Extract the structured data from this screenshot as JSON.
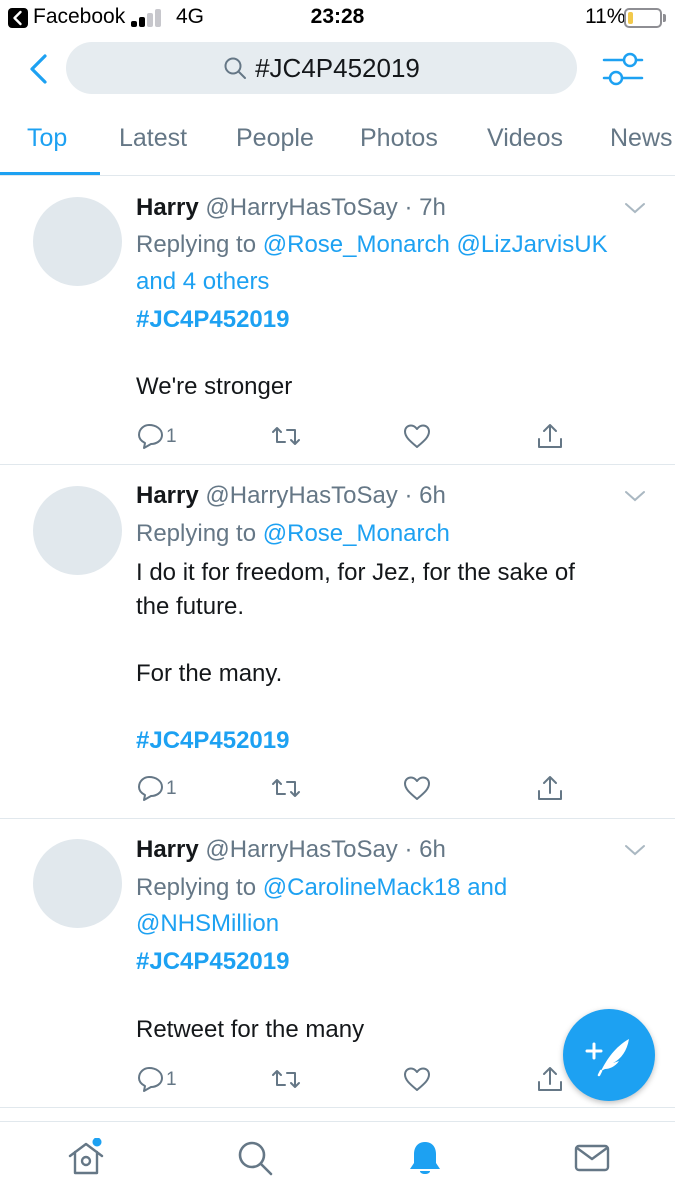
{
  "status_bar": {
    "back_app": "Facebook",
    "network": "4G",
    "time": "23:28",
    "battery": "11%"
  },
  "search": {
    "query": "#JC4P452019"
  },
  "tabs": [
    {
      "label": "Top",
      "active": true
    },
    {
      "label": "Latest",
      "active": false
    },
    {
      "label": "People",
      "active": false
    },
    {
      "label": "Photos",
      "active": false
    },
    {
      "label": "Videos",
      "active": false
    },
    {
      "label": "News",
      "active": false
    }
  ],
  "tweets": [
    {
      "name": "Harry",
      "handle_time": "@HarryHasToSay · 7h",
      "replying_prefix": "Replying to",
      "replying_line1": "@Rose_Monarch @LizJarvisUK",
      "replying_line2": "and 4 others",
      "hashtag": "#JC4P452019",
      "body": "We're stronger",
      "reply_count": "1"
    },
    {
      "name": "Harry",
      "handle_time": "@HarryHasToSay · 6h",
      "replying_prefix": "Replying to",
      "replying_line1": "@Rose_Monarch",
      "body_line1": "I do it for freedom, for Jez, for the sake of",
      "body_line2": "the future.",
      "body_line3": "For the many.",
      "hashtag": "#JC4P452019",
      "reply_count": "1"
    },
    {
      "name": "Harry",
      "handle_time": "@HarryHasToSay · 6h",
      "replying_prefix": "Replying to",
      "replying_line1": "@CarolineMack18 and",
      "replying_line2": "@NHSMillion",
      "hashtag": "#JC4P452019",
      "body": "Retweet for the many",
      "reply_count": "1"
    }
  ],
  "colors": {
    "accent": "#1da1f2",
    "secondary_text": "#657786",
    "divider": "#e1e8ed",
    "avatar_placeholder": "#e1e8ed"
  },
  "icons": {
    "status_back": "back-arrow-icon",
    "search": "search-icon",
    "filter": "sliders-icon",
    "reply": "reply-icon",
    "retweet": "retweet-icon",
    "like": "heart-icon",
    "share": "share-icon",
    "compose": "compose-tweet-icon",
    "home": "home-icon",
    "explore": "search-icon",
    "notifications": "bell-icon",
    "messages": "mail-icon"
  }
}
